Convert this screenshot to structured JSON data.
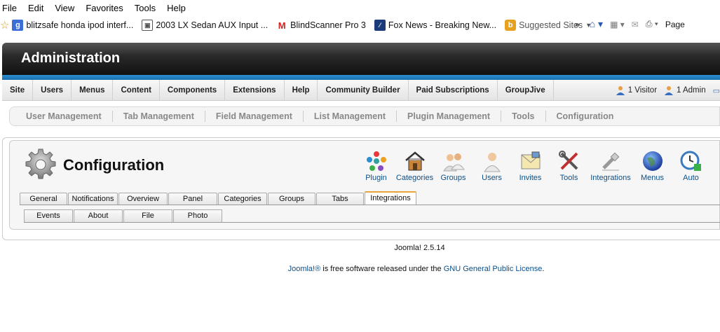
{
  "browser": {
    "menu": [
      "File",
      "Edit",
      "View",
      "Favorites",
      "Tools",
      "Help"
    ],
    "favorites": [
      {
        "label": "blitzsafe honda ipod interf...",
        "icon": "google-icon",
        "color": "#3b6fd6"
      },
      {
        "label": "2003 LX Sedan AUX Input ...",
        "icon": "page-icon",
        "color": "#555555"
      },
      {
        "label": "BlindScanner Pro 3",
        "icon": "m-logo-icon",
        "color": "#d62020"
      },
      {
        "label": "Fox News - Breaking New...",
        "icon": "fox-icon",
        "color": "#1a3a7a"
      },
      {
        "label": "Suggested Sites",
        "icon": "suggested-icon",
        "color": "#e8a020"
      }
    ],
    "right_label": "Page"
  },
  "header": {
    "title": "Administration"
  },
  "topnav": {
    "items": [
      "Site",
      "Users",
      "Menus",
      "Content",
      "Components",
      "Extensions",
      "Help",
      "Community Builder",
      "Paid Subscriptions",
      "GroupJive"
    ],
    "visitors": "1 Visitor",
    "admins": "1 Admin"
  },
  "submenu": [
    "User Management",
    "Tab Management",
    "Field Management",
    "List Management",
    "Plugin Management",
    "Tools",
    "Configuration"
  ],
  "page": {
    "title": "Configuration"
  },
  "toolbar": [
    {
      "label": "Plugin",
      "icon": "plugin-icon"
    },
    {
      "label": "Categories",
      "icon": "house-icon"
    },
    {
      "label": "Groups",
      "icon": "groups-icon"
    },
    {
      "label": "Users",
      "icon": "user-icon"
    },
    {
      "label": "Invites",
      "icon": "envelope-icon"
    },
    {
      "label": "Tools",
      "icon": "tools-icon"
    },
    {
      "label": "Integrations",
      "icon": "plug-icon"
    },
    {
      "label": "Menus",
      "icon": "globe-icon"
    },
    {
      "label": "Auto",
      "icon": "clock-icon"
    }
  ],
  "tabs": [
    "General",
    "Notifications",
    "Overview",
    "Panel",
    "Categories",
    "Groups",
    "Tabs",
    "Integrations"
  ],
  "active_tab": "Integrations",
  "subtabs": [
    "Events",
    "About",
    "File",
    "Photo"
  ],
  "footer": {
    "version": "Joomla! 2.5.14",
    "license_link1": "Joomla!®",
    "license_mid": " is free software released under the ",
    "license_link2": "GNU General Public License",
    "license_end": "."
  }
}
